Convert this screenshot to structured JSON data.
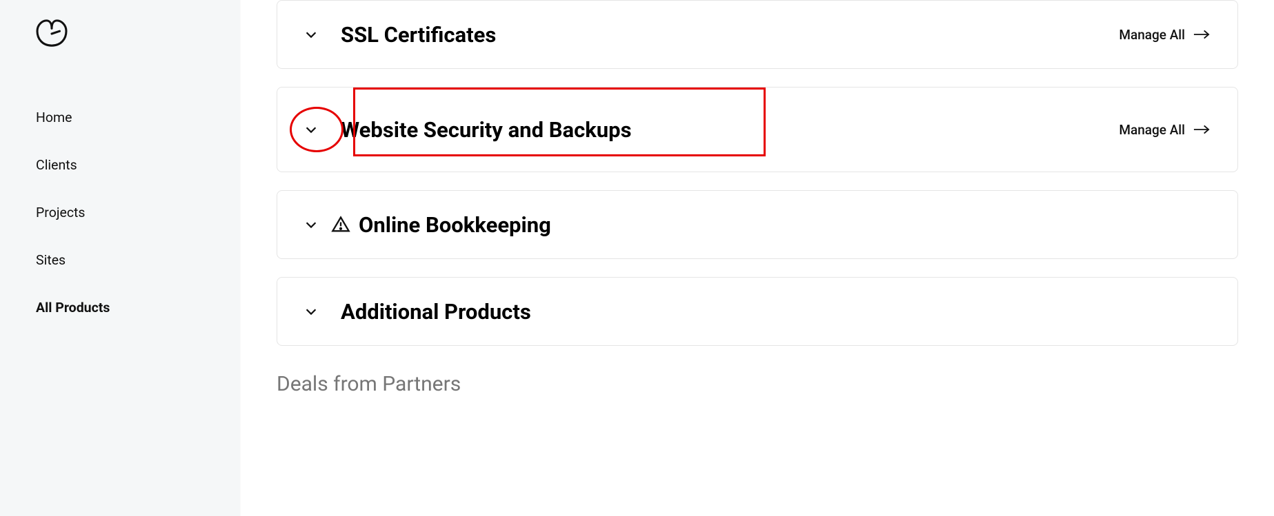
{
  "sidebar": {
    "nav": [
      {
        "label": "Home",
        "active": false
      },
      {
        "label": "Clients",
        "active": false
      },
      {
        "label": "Projects",
        "active": false
      },
      {
        "label": "Sites",
        "active": false
      },
      {
        "label": "All Products",
        "active": true
      }
    ]
  },
  "panels": {
    "ssl": {
      "title": "SSL Certificates",
      "manage_label": "Manage All"
    },
    "security": {
      "title": "Website Security and Backups",
      "manage_label": "Manage All"
    },
    "bookkeeping": {
      "title": "Online Bookkeeping"
    },
    "additional": {
      "title": "Additional Products"
    }
  },
  "partners_heading": "Deals from Partners"
}
